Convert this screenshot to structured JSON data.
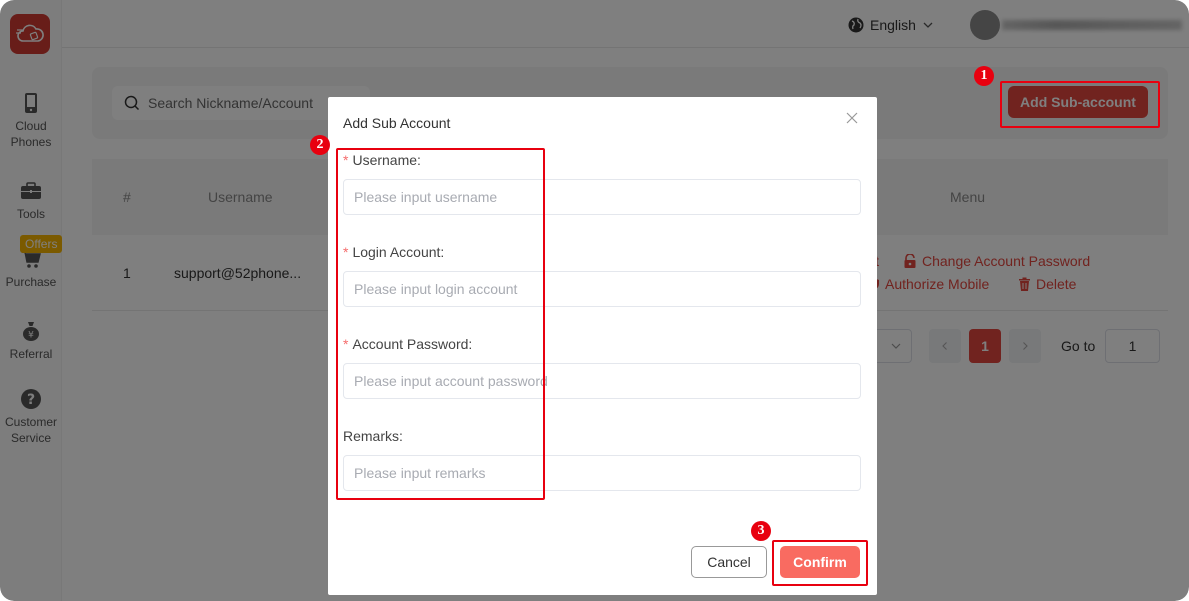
{
  "sidebar": {
    "items": [
      {
        "label_line1": "Cloud",
        "label_line2": "Phones",
        "icon": "phone-icon"
      },
      {
        "label_line1": "Tools",
        "label_line2": "",
        "icon": "briefcase-icon"
      },
      {
        "label_line1": "Purchase",
        "label_line2": "",
        "icon": "cart-icon"
      },
      {
        "label_line1": "Referral",
        "label_line2": "",
        "icon": "money-bag-icon"
      },
      {
        "label_line1": "Customer",
        "label_line2": "Service",
        "icon": "help-icon"
      }
    ],
    "offers_badge": "Offers"
  },
  "topbar": {
    "language": "English"
  },
  "toolbar": {
    "search_placeholder": "Search Nickname/Account",
    "add_button": "Add Sub-account"
  },
  "table": {
    "headers": {
      "index": "#",
      "username": "Username",
      "menu": "Menu"
    },
    "rows": [
      {
        "index": "1",
        "username": "support@52phone...",
        "actions": [
          "it",
          "Change Account Password",
          "Authorize Mobile",
          "Delete"
        ]
      }
    ]
  },
  "pagination": {
    "current_page": "1",
    "goto_label": "Go to",
    "goto_value": "1"
  },
  "modal": {
    "title": "Add Sub Account",
    "fields": [
      {
        "label": "Username:",
        "required": true,
        "placeholder": "Please input username"
      },
      {
        "label": "Login Account:",
        "required": true,
        "placeholder": "Please input login account"
      },
      {
        "label": "Account Password:",
        "required": true,
        "placeholder": "Please input account password"
      },
      {
        "label": "Remarks:",
        "required": false,
        "placeholder": "Please input remarks"
      }
    ],
    "required_mark": "*",
    "cancel": "Cancel",
    "confirm": "Confirm"
  },
  "annotations": {
    "step1": "1",
    "step2": "2",
    "step3": "3"
  },
  "colors": {
    "brand": "#e3463f",
    "annotation": "#e8000f",
    "confirm": "#f96b61"
  }
}
